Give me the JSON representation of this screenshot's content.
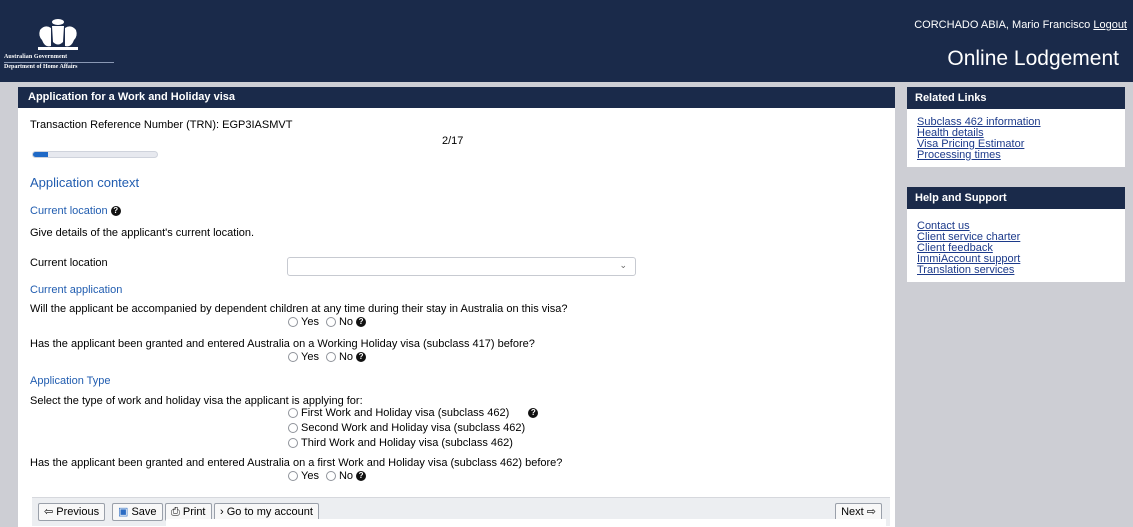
{
  "header": {
    "gov_name": "Australian Government",
    "dept_name": "Department of Home Affairs",
    "user_name": "CORCHADO ABIA, Mario Francisco",
    "logout_label": "Logout",
    "page_heading": "Online Lodgement"
  },
  "form": {
    "title": "Application for a Work and Holiday visa",
    "trn": "Transaction Reference Number (TRN): EGP3IASMVT",
    "step": "2/17",
    "progress": 0.12,
    "section_title": "Application context",
    "current_location_heading": "Current location",
    "current_location_desc": "Give details of the applicant's current location.",
    "current_location_label": "Current location",
    "current_location_value": "",
    "current_application_heading": "Current application",
    "q_children": "Will the applicant be accompanied by dependent children at any time during their stay in Australia on this visa?",
    "q_417": "Has the applicant been granted and entered Australia on a Working Holiday visa (subclass 417) before?",
    "application_type_heading": "Application Type",
    "q_type": "Select the type of work and holiday visa the applicant is applying for:",
    "type_options": [
      "First Work and Holiday visa (subclass 462)",
      "Second Work and Holiday visa (subclass 462)",
      "Third Work and Holiday visa (subclass 462)"
    ],
    "q_first462": "Has the applicant been granted and entered Australia on a first Work and Holiday visa (subclass 462) before?",
    "yes_label": "Yes",
    "no_label": "No"
  },
  "footer": {
    "previous": "⇦ Previous",
    "save": "Save",
    "print": "Print",
    "go_to_account": "Go to my account",
    "next": "Next ⇨"
  },
  "sidebar": {
    "related_title": "Related Links",
    "related_links": [
      "Subclass 462 information",
      "Health details",
      "Visa Pricing Estimator",
      "Processing times"
    ],
    "help_title": "Help and Support",
    "help_links": [
      "Contact us",
      "Client service charter",
      "Client feedback",
      "ImmiAccount support",
      "Translation services"
    ]
  }
}
